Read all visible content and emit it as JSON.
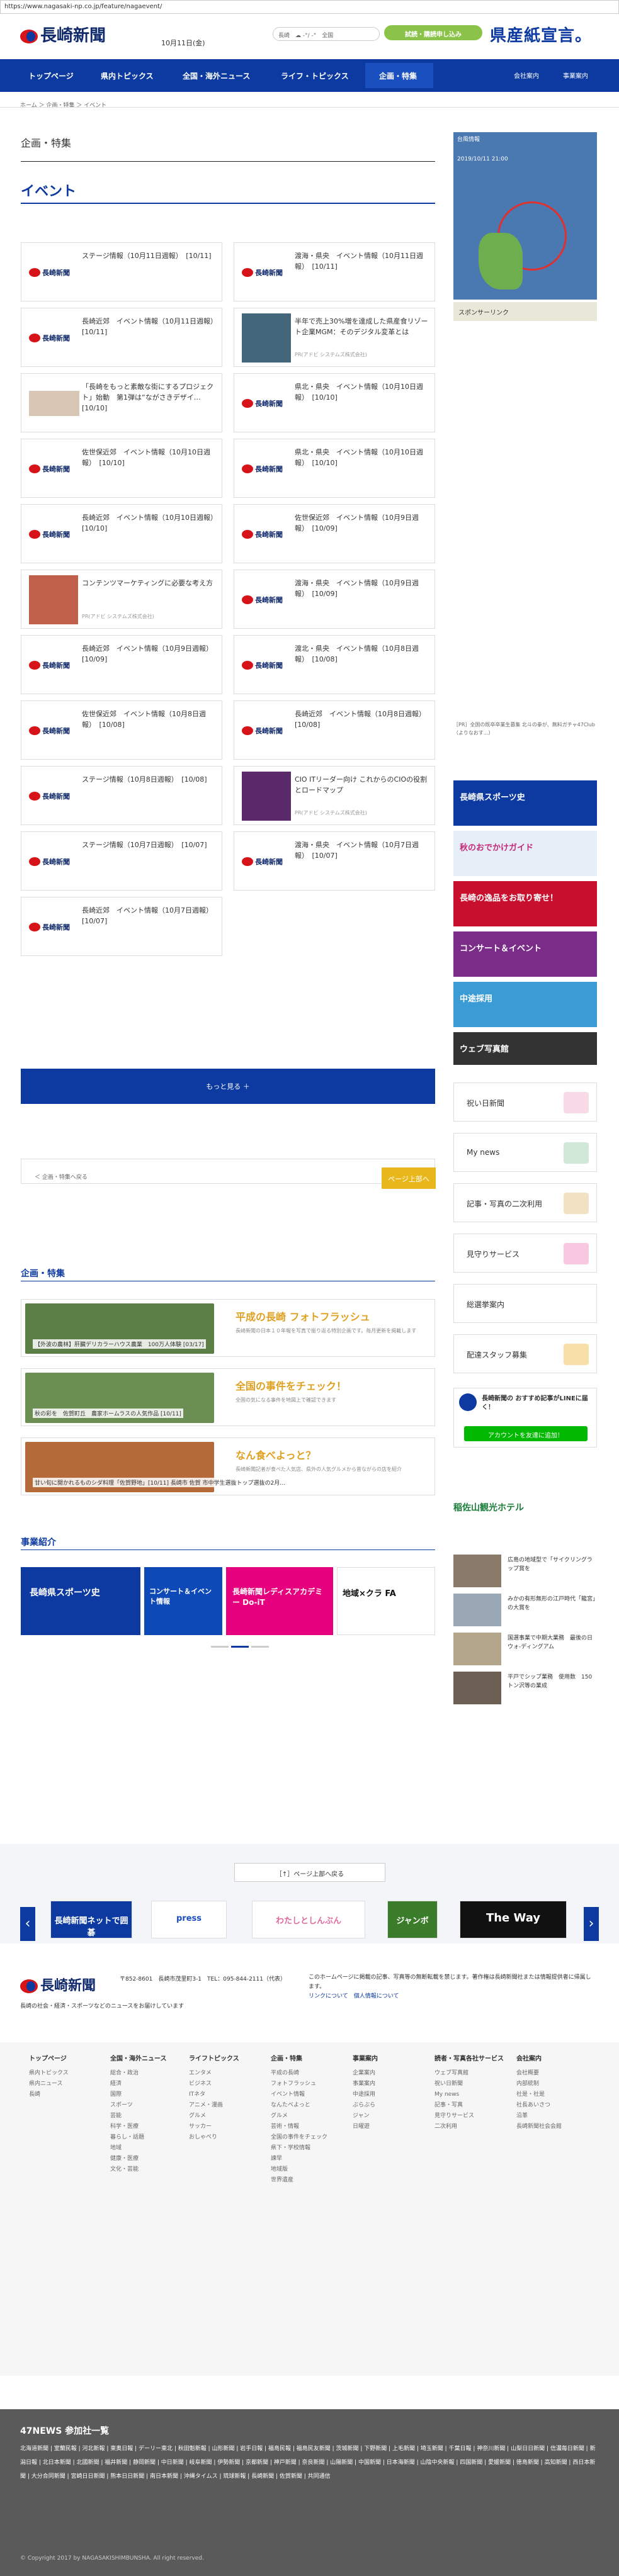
{
  "url": "https://www.nagasaki-np.co.jp/feature/nagaevent/",
  "header": {
    "logo": "長崎新聞",
    "date": "10月11日(金)",
    "weather_label": "長崎",
    "weather_link": "全国",
    "trial_label": "試読・購読申し込み",
    "campaign": "県産紙宣言。"
  },
  "nav": {
    "items": [
      "トップページ",
      "県内トピックス",
      "全国・海外ニュース",
      "ライフ・トピックス",
      "企画・特集"
    ],
    "sub": [
      "会社案内",
      "事業案内"
    ]
  },
  "breadcrumb": "ホーム ＞ 企画・特集 ＞ イベント",
  "section_title": "企画・特集",
  "page_title": "イベント",
  "cards": [
    {
      "title": "ステージ情報（10月11日週報）　[10/11]",
      "pr": ""
    },
    {
      "title": "渡海・県央　イベント情報（10月11日週報）　[10/11]",
      "pr": ""
    },
    {
      "title": "長崎近郊　イベント情報（10月11日週報）　[10/11]",
      "pr": ""
    },
    {
      "title": "半年で売上30%増を達成した県産食リゾート企業MGM：そのデジタル変革とは",
      "pr": "PR(アドビ システムズ株式会社)"
    },
    {
      "title": "「長崎をもっと素敵な街にするプロジェクト」始動　第1弾は“ながさきデザイ…　[10/10]",
      "pr": ""
    },
    {
      "title": "県北・県央　イベント情報（10月10日週報）　[10/10]",
      "pr": ""
    },
    {
      "title": "佐世保近郊　イベント情報（10月10日週報）　[10/10]",
      "pr": ""
    },
    {
      "title": "県北・県央　イベント情報（10月10日週報）　[10/10]",
      "pr": ""
    },
    {
      "title": "長崎近郊　イベント情報（10月10日週報）　[10/10]",
      "pr": ""
    },
    {
      "title": "佐世保近郊　イベント情報（10月9日週報）　[10/09]",
      "pr": ""
    },
    {
      "title": "コンテンツマーケティングに必要な考え方",
      "pr": "PR(アドビ システムズ株式会社)"
    },
    {
      "title": "渡海・県央　イベント情報（10月9日週報）　[10/09]",
      "pr": ""
    },
    {
      "title": "長崎近郊　イベント情報（10月9日週報）　[10/09]",
      "pr": ""
    },
    {
      "title": "渡北・県央　イベント情報（10月8日週報）　[10/08]",
      "pr": ""
    },
    {
      "title": "佐世保近郊　イベント情報（10月8日週報）　[10/08]",
      "pr": ""
    },
    {
      "title": "長崎近郊　イベント情報（10月8日週報）　[10/08]",
      "pr": ""
    },
    {
      "title": "ステージ情報（10月8日週報）　[10/08]",
      "pr": ""
    },
    {
      "title": "CIO ITリーダー向け これからのCIOの役割とロードマップ",
      "pr": "PR(アドビ システムズ株式会社)"
    },
    {
      "title": "ステージ情報（10月7日週報）　[10/07]",
      "pr": ""
    },
    {
      "title": "渡海・県央　イベント情報（10月7日週報）　[10/07]",
      "pr": ""
    },
    {
      "title": "長崎近郊　イベント情報（10月7日週報）　[10/07]",
      "pr": ""
    }
  ],
  "more_label": "もっと見る ＋",
  "prev_label": "＜ 企画・特集へ戻る",
  "top_label": "ページ上部へ",
  "sidebar": {
    "map_title": "台風情報",
    "map_time": "2019/10/11 21:00",
    "sponsor": "スポンサーリンク",
    "pr_text": "［PR］全国の既卒卒業生募集 北斗の拳が、無料ガチャ47Club（よりなおす...）",
    "banners": [
      "長崎県スポーツ史",
      "秋のおでかけガイド",
      "長崎の逸品をお取り寄せ！",
      "コンサート＆イベント",
      "中途採用",
      "ウェブ写真館"
    ],
    "links": [
      "祝い日新聞",
      "My news",
      "記事・写真の二次利用",
      "見守りサービス",
      "総選挙案内",
      "配達スタッフ募集"
    ],
    "line_title": "長崎新聞の おすすめ記事がLINEに届く！",
    "line_btn": "アカウントを友達に追加！",
    "hotel": "稲佐山観光ホテル",
    "news": [
      "広島の地域型で「サイクリングラップ賞を",
      "みかの有形無形の江戸時代「龍宮」の大賞を",
      "国選事業で中期大業務　最後の日ウォ-ディングアム",
      "平戸でシップ業務　使用数　150トン沢等の業成"
    ]
  },
  "features_title": "企画・特集",
  "features": [
    {
      "caption": "【外波の農林】肝臓デリカラーハウス農業　100万人体験 [03/17]",
      "head": "平成の長崎 フォトフラッシュ",
      "desc": "長崎新聞の日本１０年報を写真で振り返る特別企画です。毎月更新を掲載します"
    },
    {
      "caption": "秋の彩を　佐賀町丘　農家ホームラスの人気作品 [10/11]",
      "head": "全国の事件をチェック！",
      "desc": "全国の気になる事件を地図上で確認できます"
    },
    {
      "caption": "甘い旬に開かれるものシダ料理「佐賀野地」[10/11] 長崎市 佐賀 市中学生選抜トップ選抜の2月…",
      "head": "なん食べよっと？",
      "desc": "長崎新聞記者が食べた人気店、県外の人気グルメから昔ながらの店を紹介"
    }
  ],
  "jigyo_title": "事業紹介",
  "carousel": [
    "長崎県スポーツ史",
    "コンサート＆イベント情報",
    "長崎新聞レディスアカデミー Do-iT",
    "地域×クラ FA"
  ],
  "pagetop_label": "［↑］ページ上部へ戻る",
  "partners": [
    "長崎新聞ネットで囲碁",
    "press",
    "わたしとしんぶん",
    "ジャンボ",
    "The Way"
  ],
  "footer": {
    "logo": "長崎新聞",
    "address": "〒852-8601　長崎市茂里町3-1　TEL：095-844-2111（代表）",
    "tagline": "長崎の社会・経済・スポーツなどのニュースをお届けしています",
    "note": "このホームページに掲載の記事、写真等の無断転載を禁じます。著作権は長崎新聞社または情報提供者に帰属します。",
    "links": [
      "リンクについて",
      "個人情報について"
    ],
    "columns": [
      {
        "head": "トップページ",
        "items": [
          "県内トピックス",
          "県内ニュース",
          "長崎"
        ]
      },
      {
        "head": "全国・海外ニュース",
        "items": [
          "総合・政治",
          "経済",
          "国際",
          "スポーツ",
          "芸能",
          "科学・医療",
          "暮らし・話題",
          "地域",
          "健康・医療",
          "文化・芸能"
        ]
      },
      {
        "head": "ライフトピックス",
        "items": [
          "エンタメ",
          "ビジネス",
          "ITネタ",
          "アニメ・漫画",
          "グルメ",
          "サッカー",
          "おしゃべり"
        ]
      },
      {
        "head": "企画・特集",
        "items": [
          "平成の長崎",
          "フォトフラッシュ",
          "イベント情報",
          "なんたべよっと",
          "グルメ",
          "芸術・情報",
          "全国の事件をチェック",
          "県下・学校情報",
          "諫早",
          "地域版",
          "世界遺産"
        ]
      },
      {
        "head": "事業案内",
        "items": [
          "企業案内",
          "事業案内",
          "中途採用",
          "ぶらぶら",
          "ジャン",
          "日曜遊"
        ]
      },
      {
        "head": "読者・写真各社サービス",
        "items": [
          "ウェブ写真館",
          "祝い日新聞",
          "My news",
          "記事・写真",
          "見守りサービス",
          "二次利用"
        ]
      },
      {
        "head": "会社案内",
        "items": [
          "会社概要",
          "内部統制",
          "社是・社是",
          "社長あいさつ",
          "沿革",
          "長崎新聞社会会館"
        ]
      }
    ]
  },
  "n47": {
    "title": "47NEWS 参加社一覧",
    "sites": "北海道新聞 | 室蘭民報 | 河北新報 | 東奥日報 | デーリー東北 | 秋田魁新報 | 山形新聞 | 岩手日報 | 福島民報 | 福島民友新聞 | 茨城新聞 | 下野新聞 | 上毛新聞 | 埼玉新聞 | 千葉日報 | 神奈川新聞 | 山梨日日新聞 | 信濃毎日新聞 | 新潟日報 | 北日本新聞 | 北國新聞 | 福井新聞 | 静岡新聞 | 中日新聞 | 岐阜新聞 | 伊勢新聞 | 京都新聞 | 神戸新聞 | 奈良新聞 | 山陽新聞 | 中国新聞 | 日本海新聞 | 山陰中央新報 | 四国新聞 | 愛媛新聞 | 徳島新聞 | 高知新聞 | 西日本新聞 | 大分合同新聞 | 宮崎日日新聞 | 熊本日日新聞 | 南日本新聞 | 沖縄タイムス | 琉球新報 | 長崎新聞 | 佐賀新聞 | 共同通信"
  },
  "copyright": "© Copyright 2017 by NAGASAKISHIMBUNSHA. All right reserved."
}
